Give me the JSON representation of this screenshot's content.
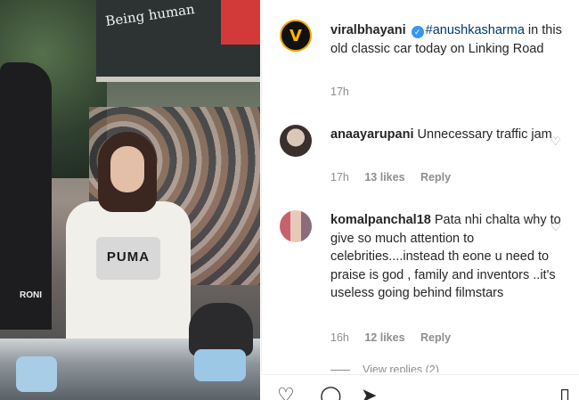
{
  "post": {
    "author": "viralbhayani",
    "mention": "#anushkasharma",
    "caption": " in this old classic car today on Linking Road",
    "time": "17h",
    "avatar_icon": "V",
    "verified_glyph": "✓",
    "image_text": {
      "shirt": "PUMA",
      "store_sign": "Being human",
      "badge": "RONI"
    }
  },
  "comments": [
    {
      "user": "anaayarupani",
      "text": " Unnecessary traffic jam",
      "time": "17h",
      "likes": "13 likes",
      "reply": "Reply"
    },
    {
      "user": "komalpanchal18",
      "text": " Pata nhi chalta why to give so much attention to celebrities....instead th eone u need to praise is god , family and inventors ..it's useless going behind filmstars",
      "time": "16h",
      "likes": "12 likes",
      "reply": "Reply"
    }
  ],
  "view_replies": "View replies (2)",
  "icons": [
    "heart-icon",
    "comment-icon",
    "share-icon",
    "save-icon"
  ],
  "colors": {
    "link": "#00376b",
    "meta": "#8e8e8e",
    "verified": "#3897f0"
  }
}
